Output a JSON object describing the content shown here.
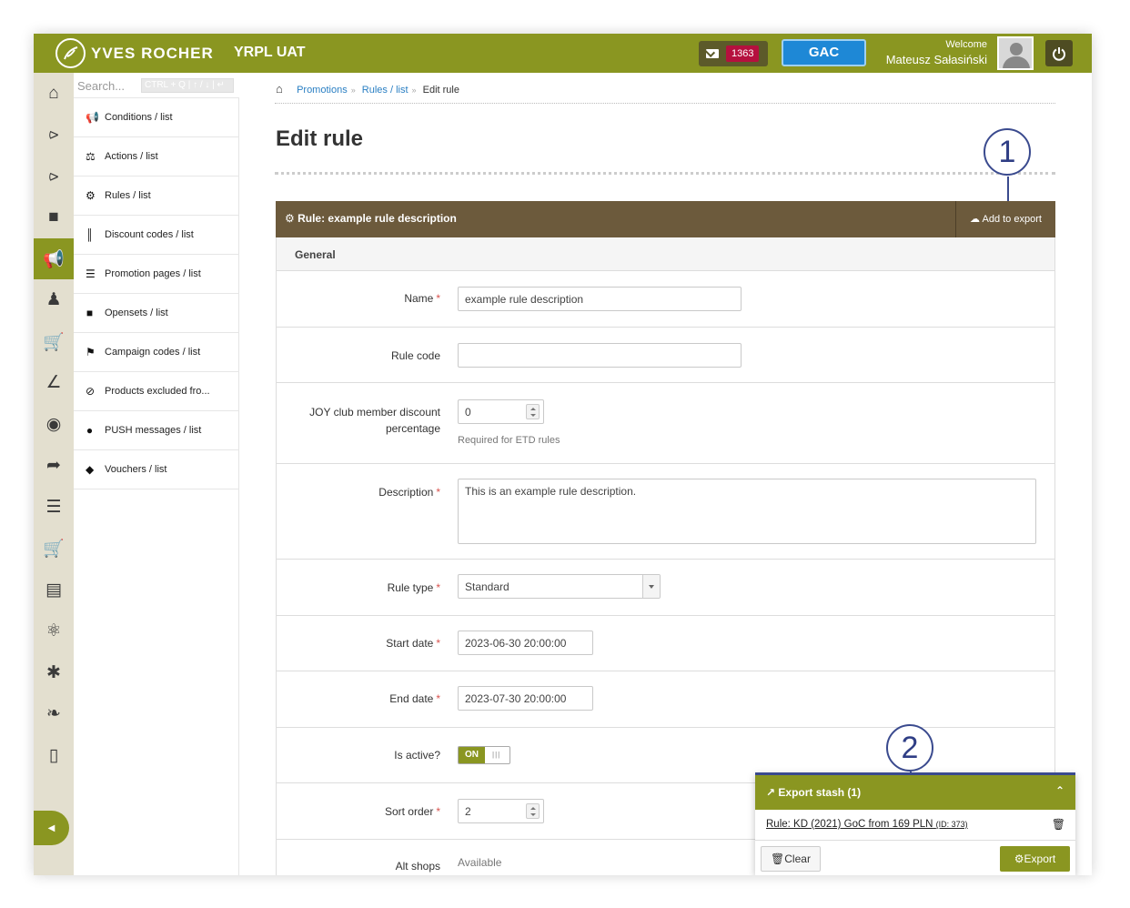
{
  "header": {
    "brand": "YVES ROCHER",
    "environment": "YRPL UAT",
    "messages_count": "1363",
    "store_button": "GAC",
    "welcome": "Welcome",
    "user_name": "Mateusz Sałasiński"
  },
  "rail": {
    "icons": [
      "home-icon",
      "share-icon",
      "share-icon",
      "folder-icon",
      "megaphone-icon",
      "users-icon",
      "cart-icon",
      "chart-icon",
      "globe-icon",
      "forward-icon",
      "sliders-icon",
      "cart-icon",
      "id-card-icon",
      "atom-icon",
      "asterisk-icon",
      "leaf-icon",
      "mobile-icon"
    ],
    "active_index": 4
  },
  "submenu": {
    "search_placeholder": "Search...",
    "search_shortcut": "CTRL + Q | ↑ / ↓ | ↵",
    "items": [
      {
        "icon": "megaphone-icon",
        "label": "Conditions / list"
      },
      {
        "icon": "flask-icon",
        "label": "Actions / list"
      },
      {
        "icon": "gears-icon",
        "label": "Rules / list"
      },
      {
        "icon": "barcode-icon",
        "label": "Discount codes / list"
      },
      {
        "icon": "list-icon",
        "label": "Promotion pages / list"
      },
      {
        "icon": "folder-icon",
        "label": "Opensets / list"
      },
      {
        "icon": "flag-icon",
        "label": "Campaign codes / list"
      },
      {
        "icon": "ban-icon",
        "label": "Products excluded fro..."
      },
      {
        "icon": "comment-icon",
        "label": "PUSH messages / list"
      },
      {
        "icon": "tag-icon",
        "label": "Vouchers / list"
      }
    ]
  },
  "breadcrumb": {
    "items": [
      "Promotions",
      "Rules / list"
    ],
    "current": "Edit rule"
  },
  "page": {
    "title": "Edit rule",
    "panel_title": "Rule: example rule description",
    "add_to_export": "Add to export",
    "section": "General"
  },
  "form": {
    "name": {
      "label": "Name",
      "value": "example rule description"
    },
    "rule_code": {
      "label": "Rule code",
      "value": ""
    },
    "joy": {
      "label_line1": "JOY club member discount",
      "label_line2": "percentage",
      "value": "0",
      "help": "Required for ETD rules"
    },
    "description": {
      "label": "Description",
      "value": "This is an example rule description."
    },
    "rule_type": {
      "label": "Rule type",
      "value": "Standard"
    },
    "start_date": {
      "label": "Start date",
      "value": "2023-06-30 20:00:00"
    },
    "end_date": {
      "label": "End date",
      "value": "2023-07-30 20:00:00"
    },
    "is_active": {
      "label": "Is active?",
      "value": "ON"
    },
    "sort_order": {
      "label": "Sort order",
      "value": "2"
    },
    "alt_shops": {
      "label": "Alt shops",
      "value": "Available"
    }
  },
  "callouts": [
    "1",
    "2"
  ],
  "export_stash": {
    "title": "Export stash (1)",
    "item": "Rule: KD (2021) GoC from 169 PLN",
    "item_id": "(ID: 373)",
    "clear": "Clear",
    "export": "Export"
  },
  "colors": {
    "accent": "#8a9621",
    "panel_header": "#6c5a3c",
    "link": "#2a7fc3",
    "badge": "#b5103e",
    "store_button": "#1e88d6",
    "callout": "#3a4a8e"
  }
}
